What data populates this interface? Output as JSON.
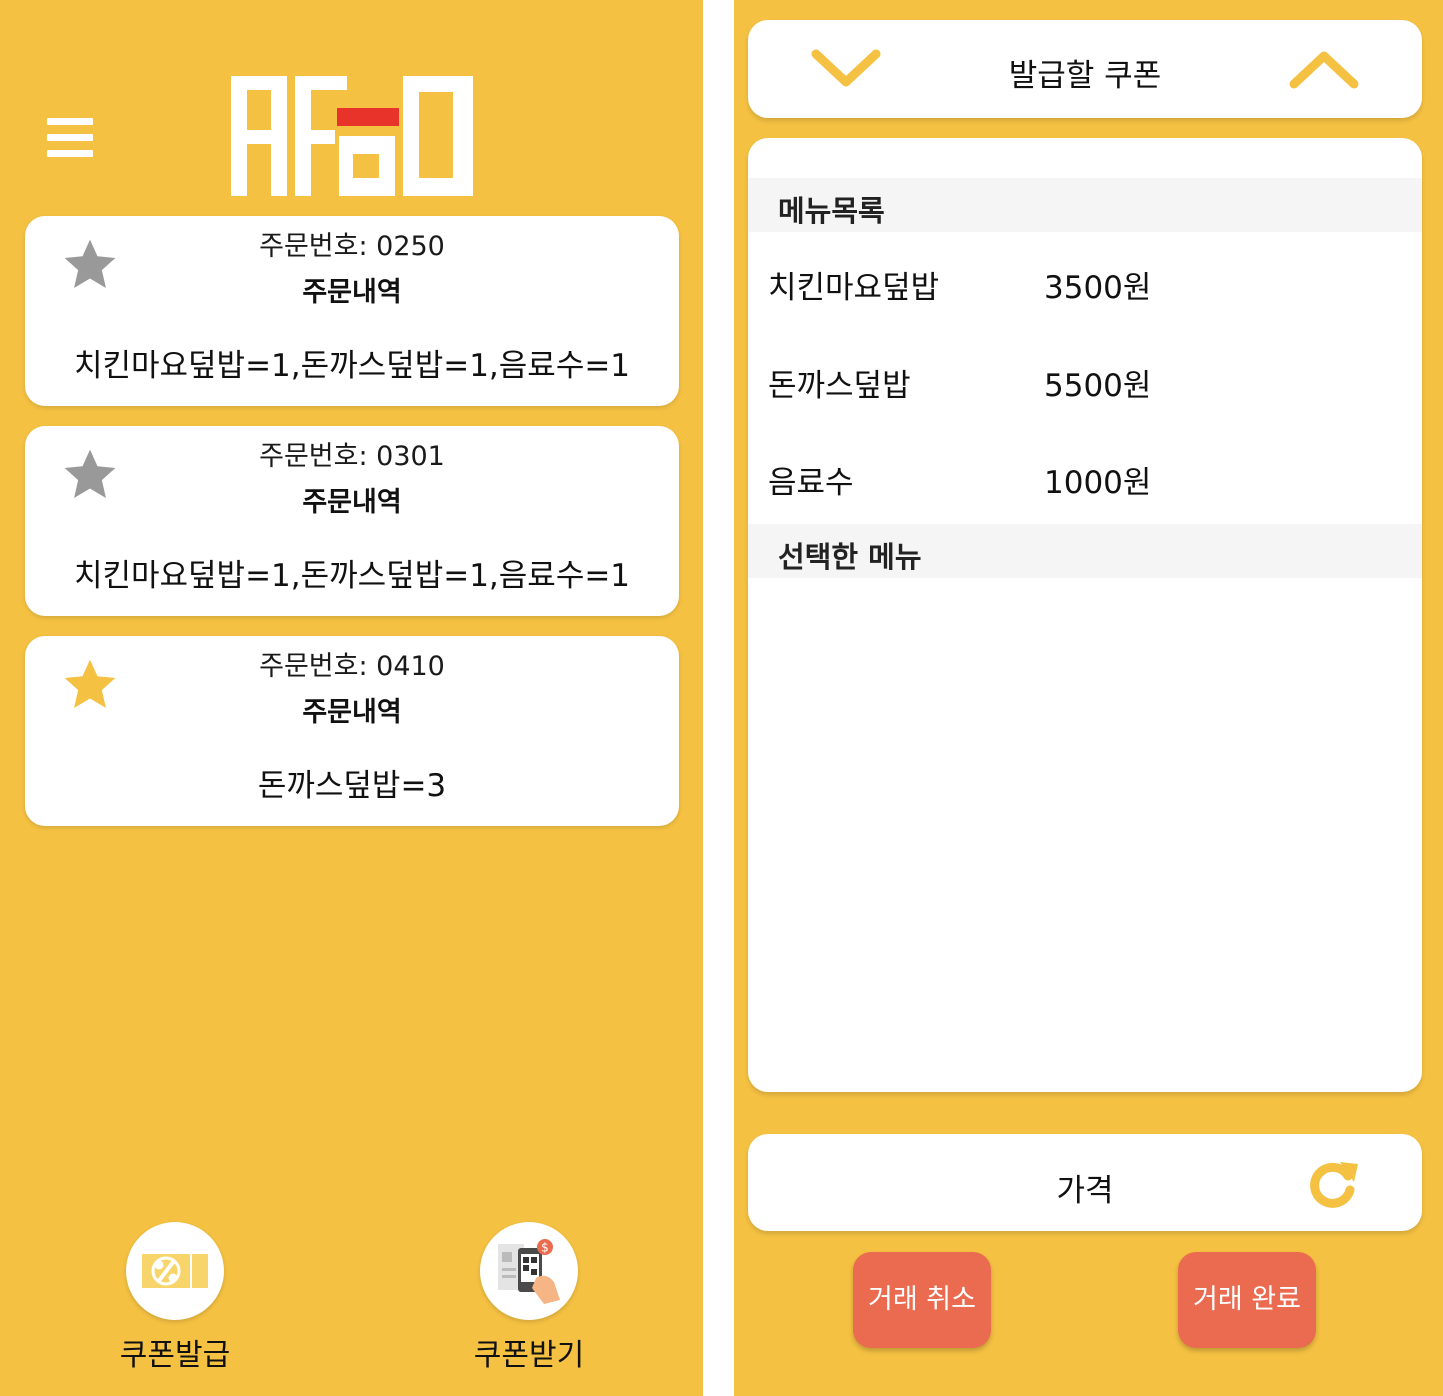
{
  "colors": {
    "background": "#f4c142",
    "card": "#ffffff",
    "star_inactive": "#999999",
    "star_active": "#f4c142",
    "logo_accent": "#e8332a",
    "action_button": "#ea6b4f"
  },
  "left": {
    "menu_icon": "hamburger-menu-icon",
    "logo_icon": "afoo-logo",
    "orders": [
      {
        "number_label": "주문번호: 0250",
        "heading": "주문내역",
        "items": "치킨마요덮밥=1,돈까스덮밥=1,음료수=1",
        "starred": false,
        "star_color": "#999999"
      },
      {
        "number_label": "주문번호: 0301",
        "heading": "주문내역",
        "items": "치킨마요덮밥=1,돈까스덮밥=1,음료수=1",
        "starred": false,
        "star_color": "#999999"
      },
      {
        "number_label": "주문번호: 0410",
        "heading": "주문내역",
        "items": "돈까스덮밥=3",
        "starred": true,
        "star_color": "#f4c142"
      }
    ],
    "bottom_actions": {
      "issue_coupon": {
        "label": "쿠폰발급",
        "icon": "coupon-percent-icon"
      },
      "receive_coupon": {
        "label": "쿠폰받기",
        "icon": "qr-phone-payment-icon"
      }
    }
  },
  "right": {
    "header": {
      "title": "발급할 쿠폰",
      "prev_icon": "chevron-down-icon",
      "next_icon": "chevron-up-icon"
    },
    "menu_section_title": "메뉴목록",
    "menu_items": [
      {
        "name": "치킨마요덮밥",
        "price": "3500원"
      },
      {
        "name": "돈까스덮밥",
        "price": "5500원"
      },
      {
        "name": "음료수",
        "price": "1000원"
      }
    ],
    "selected_section_title": "선택한 메뉴",
    "price_bar": {
      "label": "가격",
      "icon": "refresh-icon"
    },
    "cancel_button": "거래 취소",
    "complete_button": "거래 완료"
  }
}
